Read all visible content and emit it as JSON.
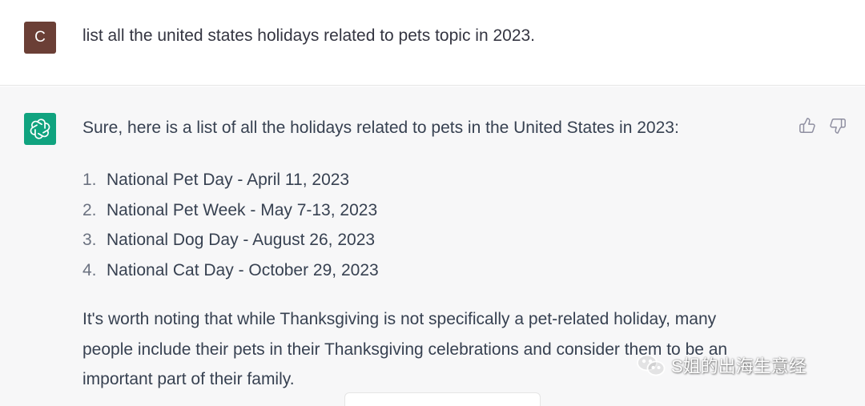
{
  "user": {
    "avatar_letter": "C",
    "avatar_color": "#6b3f36",
    "message": "list all the united states holidays related to pets topic in 2023."
  },
  "assistant": {
    "avatar_color": "#10a37f",
    "avatar_icon": "openai-logo-icon",
    "intro": "Sure, here is a list of all the holidays related to pets in the United States in 2023:",
    "items": [
      {
        "num": "1.",
        "text": "National Pet Day - April 11, 2023"
      },
      {
        "num": "2.",
        "text": "National Pet Week - May 7-13, 2023"
      },
      {
        "num": "3.",
        "text": "National Dog Day - August 26, 2023"
      },
      {
        "num": "4.",
        "text": "National Cat Day - October 29, 2023"
      }
    ],
    "note": "It's worth noting that while Thanksgiving is not specifically a pet-related holiday, many people include their pets in their Thanksgiving celebrations and consider them to be an important part of their family.",
    "feedback_icons": [
      "thumbs-up-icon",
      "thumbs-down-icon"
    ]
  },
  "watermark": {
    "text": "S姐的出海生意经",
    "icon": "wechat-icon"
  }
}
